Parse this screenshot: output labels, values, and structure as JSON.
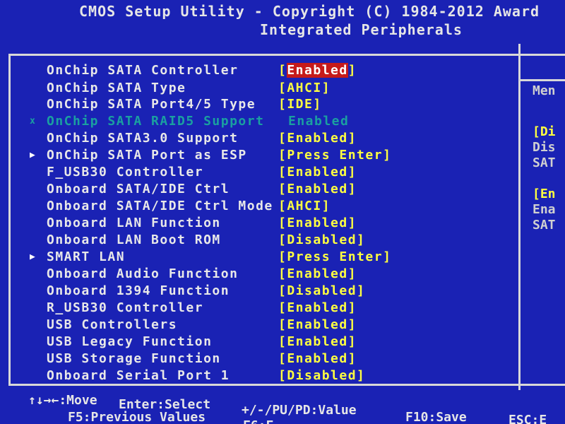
{
  "title": {
    "line1": "CMOS Setup Utility - Copyright (C) 1984-2012 Award",
    "line2": "Integrated Peripherals"
  },
  "items": [
    {
      "marker": "",
      "label": "OnChip SATA Controller",
      "value_open": "[",
      "value": "Enabled",
      "value_close": "]",
      "selected": true
    },
    {
      "marker": "",
      "label": "OnChip SATA Type",
      "value_open": "[",
      "value": "AHCI",
      "value_close": "]"
    },
    {
      "marker": "",
      "label": "OnChip SATA Port4/5 Type",
      "value_open": "[",
      "value": "IDE",
      "value_close": "]"
    },
    {
      "marker": "x",
      "label": "OnChip SATA RAID5 Support",
      "value_open": "",
      "value": "Enabled",
      "value_close": "",
      "disabled": true
    },
    {
      "marker": "",
      "label": "OnChip SATA3.0 Support",
      "value_open": "[",
      "value": "Enabled",
      "value_close": "]"
    },
    {
      "marker": "▶",
      "label": "OnChip SATA Port as ESP",
      "value_open": "[",
      "value": "Press Enter",
      "value_close": "]"
    },
    {
      "marker": "",
      "label": "F_USB30 Controller",
      "value_open": "[",
      "value": "Enabled",
      "value_close": "]"
    },
    {
      "marker": "",
      "label": "Onboard SATA/IDE Ctrl",
      "value_open": "[",
      "value": "Enabled",
      "value_close": "]"
    },
    {
      "marker": "",
      "label": "Onboard SATA/IDE Ctrl Mode",
      "value_open": "[",
      "value": "AHCI",
      "value_close": "]"
    },
    {
      "marker": "",
      "label": "Onboard LAN Function",
      "value_open": "[",
      "value": "Enabled",
      "value_close": "]"
    },
    {
      "marker": "",
      "label": "Onboard LAN Boot ROM",
      "value_open": "[",
      "value": "Disabled",
      "value_close": "]"
    },
    {
      "marker": "▶",
      "label": "SMART LAN",
      "value_open": "[",
      "value": "Press Enter",
      "value_close": "]"
    },
    {
      "marker": "",
      "label": "Onboard Audio Function",
      "value_open": "[",
      "value": "Enabled",
      "value_close": "]"
    },
    {
      "marker": "",
      "label": "Onboard 1394 Function",
      "value_open": "[",
      "value": "Disabled",
      "value_close": "]"
    },
    {
      "marker": "",
      "label": "R_USB30 Controller",
      "value_open": "[",
      "value": "Enabled",
      "value_close": "]"
    },
    {
      "marker": "",
      "label": "USB Controllers",
      "value_open": "[",
      "value": "Enabled",
      "value_close": "]"
    },
    {
      "marker": "",
      "label": "USB Legacy Function",
      "value_open": "[",
      "value": "Enabled",
      "value_close": "]"
    },
    {
      "marker": "",
      "label": "USB Storage Function",
      "value_open": "[",
      "value": "Enabled",
      "value_close": "]"
    },
    {
      "marker": "",
      "label": "Onboard Serial Port 1",
      "value_open": "[",
      "value": "Disabled",
      "value_close": "]"
    }
  ],
  "help": {
    "line1": "Men",
    "line2": "[Di",
    "line3": "Dis",
    "line4": "SAT",
    "line5": "[En",
    "line6": "Ena",
    "line7": "SAT"
  },
  "footer": {
    "move": "↑↓→←:Move",
    "select": "Enter:Select",
    "value": "+/-/PU/PD:Value",
    "f10": "F10:Save",
    "esc": "ESC:E",
    "f5": "F5:Previous Values",
    "f6": "F6:F"
  },
  "colors": {
    "background": "#1a22b4",
    "value_text": "#ffff40",
    "label_text": "#e8e8e8",
    "highlight_bg": "#c61a1a",
    "disabled_text": "#1aa0a0"
  }
}
